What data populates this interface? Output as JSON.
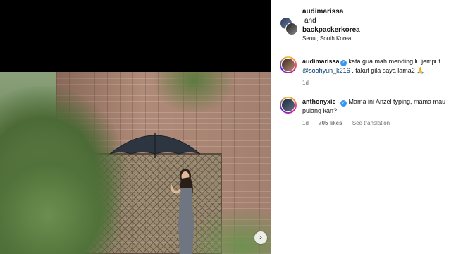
{
  "post": {
    "author1": "audimarissa",
    "conjunction": "and",
    "author2": "backpackerkorea",
    "location": "Seoul, South Korea"
  },
  "comments": [
    {
      "username": "audimarissa",
      "text_before": "kata gua mah mending lu jemput ",
      "mention": "@soohyun_k216",
      "text_after": " . takut gila saya lama2 🙏",
      "time": "1d"
    },
    {
      "username": "anthonyxie_",
      "text": "Mama ini Anzel typing, mama mau pulang kan?",
      "time": "1d",
      "likes": "705 likes",
      "see_translation": "See translation"
    }
  ],
  "icons": {
    "verified": "✓",
    "carousel_next": "›",
    "more": "…"
  },
  "colors": {
    "verified_badge": "#3897f0",
    "mention": "#00376b",
    "meta_text": "#737373"
  }
}
